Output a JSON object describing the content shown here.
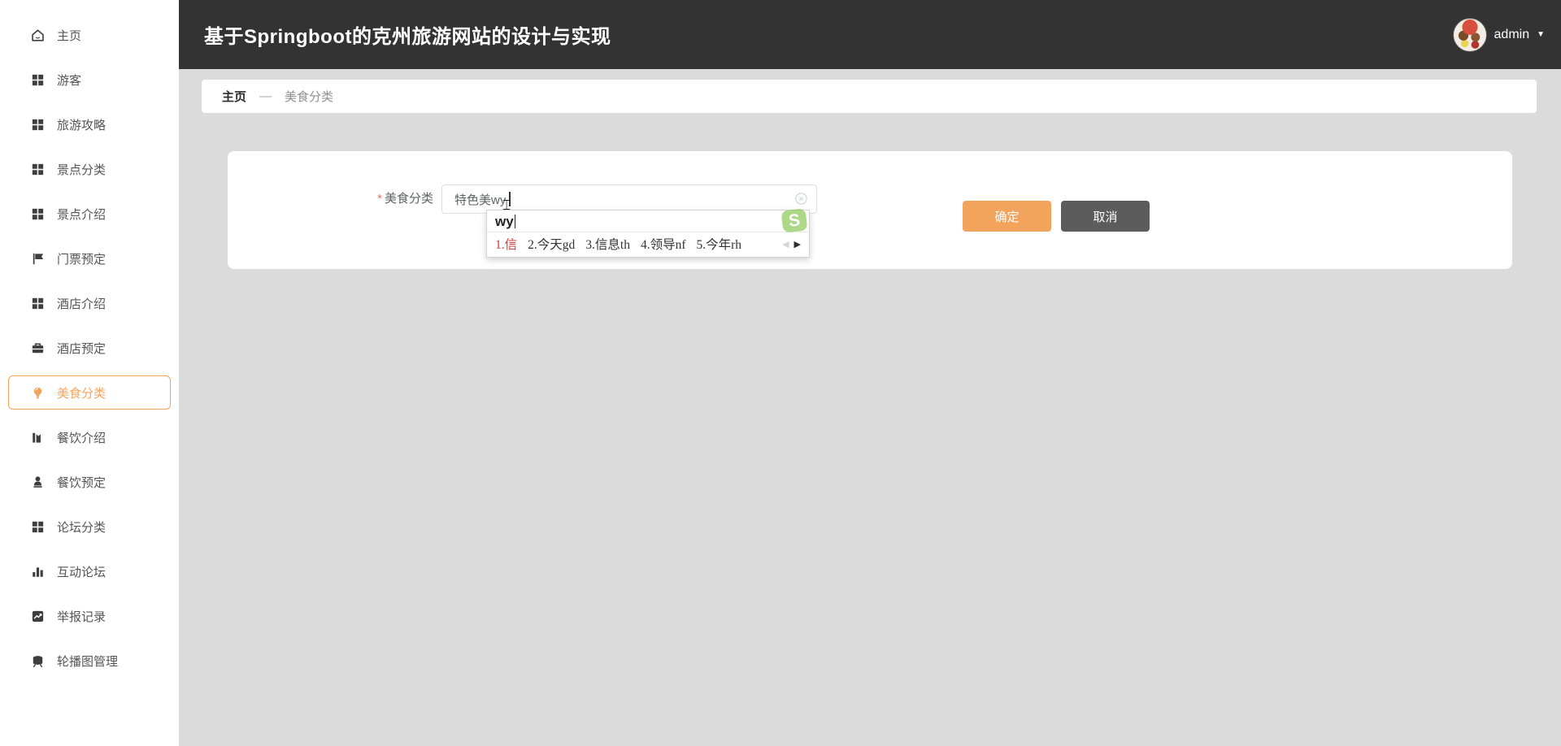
{
  "header": {
    "title": "基于Springboot的克州旅游网站的设计与实现",
    "username": "admin",
    "dropdown_arrow": "▼"
  },
  "sidebar": {
    "items": [
      {
        "name": "home",
        "label": "主页",
        "icon": "home-icon",
        "active": false
      },
      {
        "name": "tourist",
        "label": "游客",
        "icon": "grid-icon",
        "active": false
      },
      {
        "name": "travel-guide",
        "label": "旅游攻略",
        "icon": "grid-icon",
        "active": false
      },
      {
        "name": "scenic-category",
        "label": "景点分类",
        "icon": "grid-icon",
        "active": false
      },
      {
        "name": "scenic-intro",
        "label": "景点介绍",
        "icon": "grid-icon",
        "active": false
      },
      {
        "name": "ticket-booking",
        "label": "门票预定",
        "icon": "flag-icon",
        "active": false
      },
      {
        "name": "hotel-intro",
        "label": "酒店介绍",
        "icon": "grid-icon",
        "active": false
      },
      {
        "name": "hotel-booking",
        "label": "酒店预定",
        "icon": "briefcase-icon",
        "active": false
      },
      {
        "name": "food-category",
        "label": "美食分类",
        "icon": "lightbulb-icon",
        "active": true
      },
      {
        "name": "dining-intro",
        "label": "餐饮介绍",
        "icon": "building-icon",
        "active": false
      },
      {
        "name": "dining-booking",
        "label": "餐饮预定",
        "icon": "person-icon",
        "active": false
      },
      {
        "name": "forum-category",
        "label": "论坛分类",
        "icon": "grid-icon",
        "active": false
      },
      {
        "name": "interactive-forum",
        "label": "互动论坛",
        "icon": "bar-chart-icon",
        "active": false
      },
      {
        "name": "report-records",
        "label": "举报记录",
        "icon": "trend-chart-icon",
        "active": false
      },
      {
        "name": "carousel-management",
        "label": "轮播图管理",
        "icon": "screen-icon",
        "active": false
      }
    ]
  },
  "breadcrumb": {
    "home": "主页",
    "separator": "—",
    "current": "美食分类"
  },
  "form": {
    "required_mark": "*",
    "label": "美食分类",
    "input_value": "特色美wy",
    "confirm_label": "确定",
    "cancel_label": "取消"
  },
  "ime": {
    "composition": "wy",
    "candidates": [
      "1.信",
      "2.今天gd",
      "3.信息th",
      "4.领导nf",
      "5.今年rh"
    ],
    "prev_arrow": "◀",
    "next_arrow": "▶",
    "logo_letter": "S"
  },
  "cursor": {
    "ibeam_glyph": "⌶"
  },
  "colors": {
    "header_bg": "#333333",
    "content_bg": "#dbdbdb",
    "accent_orange": "#f2a45c",
    "cancel_gray": "#5c5c5c",
    "candidate_red": "#d43b3b",
    "sogou_green": "#76bf3a",
    "required_red": "#f56c6c"
  }
}
